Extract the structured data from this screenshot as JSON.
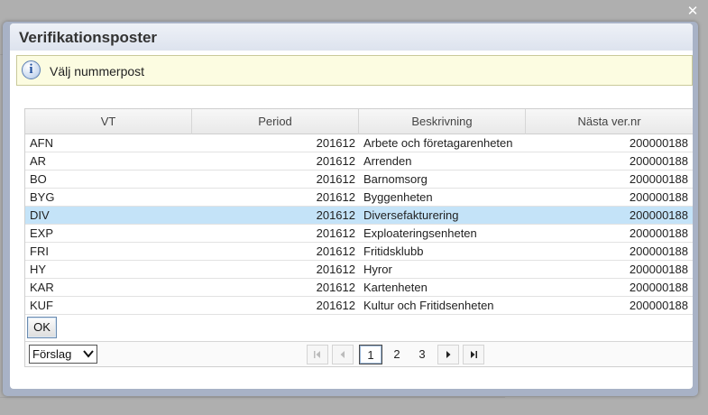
{
  "dialog": {
    "title": "Verifikationsposter",
    "info_text": "Välj nummerpost",
    "close_icon": "close-icon",
    "info_icon": "info-icon"
  },
  "grid": {
    "columns": [
      "VT",
      "Period",
      "Beskrivning",
      "Nästa ver.nr"
    ],
    "rows": [
      {
        "vt": "AFN",
        "period": "201612",
        "desc": "Arbete och företagarenheten",
        "next": "200000188",
        "selected": false
      },
      {
        "vt": "AR",
        "period": "201612",
        "desc": "Arrenden",
        "next": "200000188",
        "selected": false
      },
      {
        "vt": "BO",
        "period": "201612",
        "desc": "Barnomsorg",
        "next": "200000188",
        "selected": false
      },
      {
        "vt": "BYG",
        "period": "201612",
        "desc": "Byggenheten",
        "next": "200000188",
        "selected": false
      },
      {
        "vt": "DIV",
        "period": "201612",
        "desc": "Diversefakturering",
        "next": "200000188",
        "selected": true
      },
      {
        "vt": "EXP",
        "period": "201612",
        "desc": "Exploateringsenheten",
        "next": "200000188",
        "selected": false
      },
      {
        "vt": "FRI",
        "period": "201612",
        "desc": "Fritidsklubb",
        "next": "200000188",
        "selected": false
      },
      {
        "vt": "HY",
        "period": "201612",
        "desc": "Hyror",
        "next": "200000188",
        "selected": false
      },
      {
        "vt": "KAR",
        "period": "201612",
        "desc": "Kartenheten",
        "next": "200000188",
        "selected": false
      },
      {
        "vt": "KUF",
        "period": "201612",
        "desc": "Kultur och Fritidsenheten",
        "next": "200000188",
        "selected": false
      }
    ],
    "selected_color": "#c4e3f8"
  },
  "actions": {
    "ok_label": "OK"
  },
  "pager": {
    "page_size_select": "Förslag",
    "pages": [
      "1",
      "2",
      "3"
    ],
    "current_page": "1"
  }
}
